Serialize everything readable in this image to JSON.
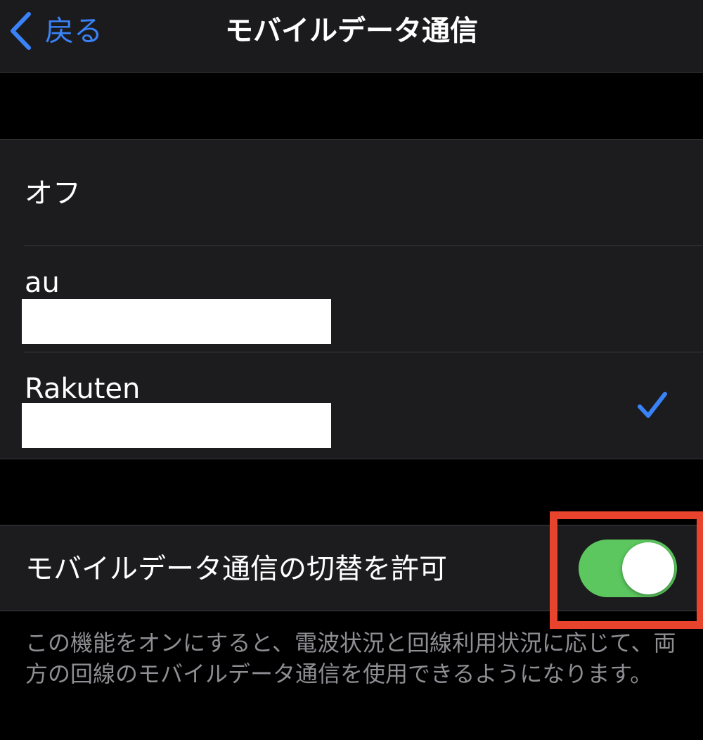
{
  "nav": {
    "back_label": "戻る",
    "title": "モバイルデータ通信"
  },
  "carriers": {
    "options": [
      {
        "label": "オフ",
        "selected": false
      },
      {
        "label": "au",
        "selected": false
      },
      {
        "label": "Rakuten",
        "selected": true
      }
    ]
  },
  "switching": {
    "label": "モバイルデータ通信の切替を許可",
    "enabled": true,
    "toggle_color": "#5bc75e",
    "highlight_color": "#e8432d"
  },
  "footer": {
    "description": "この機能をオンにすると、電波状況と回線利用状況に応じて、両方の回線のモバイルデータ通信を使用できるようになります。"
  },
  "colors": {
    "accent": "#3a82f7",
    "background": "#000000",
    "cell": "#1c1c1e",
    "secondary_text": "#8e8e93"
  }
}
